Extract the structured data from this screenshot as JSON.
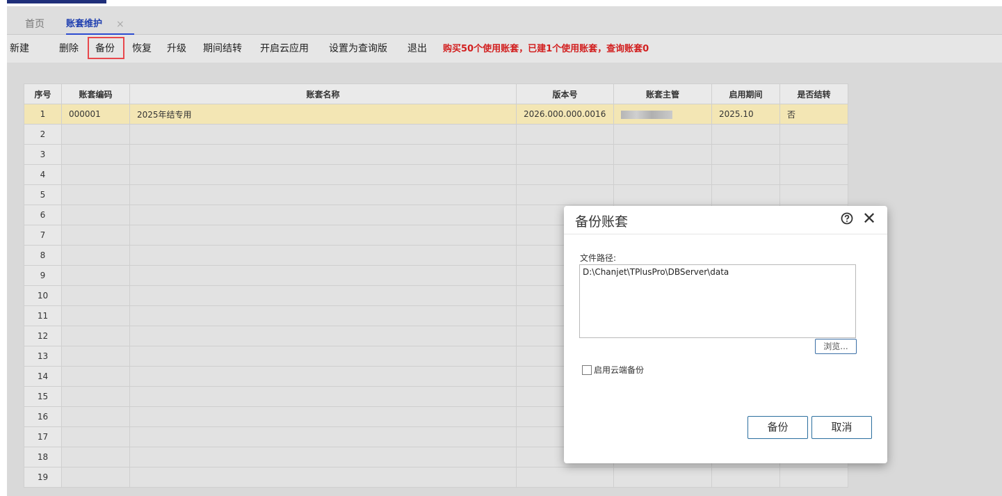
{
  "tabs": {
    "home": "首页",
    "active": "账套维护",
    "close": "×"
  },
  "toolbar": {
    "new": "新建",
    "delete": "删除",
    "backup": "备份",
    "restore": "恢复",
    "upgrade": "升级",
    "period_close": "期间结转",
    "cloud": "开启云应用",
    "query_version": "设置为查询版",
    "exit": "退出",
    "notice": "购买50个使用账套，已建1个使用账套，查询账套0"
  },
  "table": {
    "headers": [
      "序号",
      "账套编码",
      "账套名称",
      "版本号",
      "账套主管",
      "启用期间",
      "是否结转"
    ],
    "rows": [
      {
        "no": "1",
        "code": "000001",
        "name": "2025年结专用",
        "version": "2026.000.000.0016",
        "manager": "",
        "period": "2025.10",
        "closed": "否"
      },
      {
        "no": "2"
      },
      {
        "no": "3"
      },
      {
        "no": "4"
      },
      {
        "no": "5"
      },
      {
        "no": "6"
      },
      {
        "no": "7"
      },
      {
        "no": "8"
      },
      {
        "no": "9"
      },
      {
        "no": "10"
      },
      {
        "no": "11"
      },
      {
        "no": "12"
      },
      {
        "no": "13"
      },
      {
        "no": "14"
      },
      {
        "no": "15"
      },
      {
        "no": "16"
      },
      {
        "no": "17"
      },
      {
        "no": "18"
      },
      {
        "no": "19"
      }
    ]
  },
  "dialog": {
    "title": "备份账套",
    "path_label": "文件路径:",
    "path_value": "D:\\Chanjet\\TPlusPro\\DBServer\\data",
    "browse": "浏览...",
    "cloud_backup": "启用云端备份",
    "ok": "备份",
    "cancel": "取消",
    "close": "✕"
  },
  "colors": {
    "accent": "#1f2f7a",
    "tab_active": "#1f3fb0",
    "notice": "#d22020",
    "highlight": "#e8474c",
    "selected_row": "#f3e6b4"
  }
}
